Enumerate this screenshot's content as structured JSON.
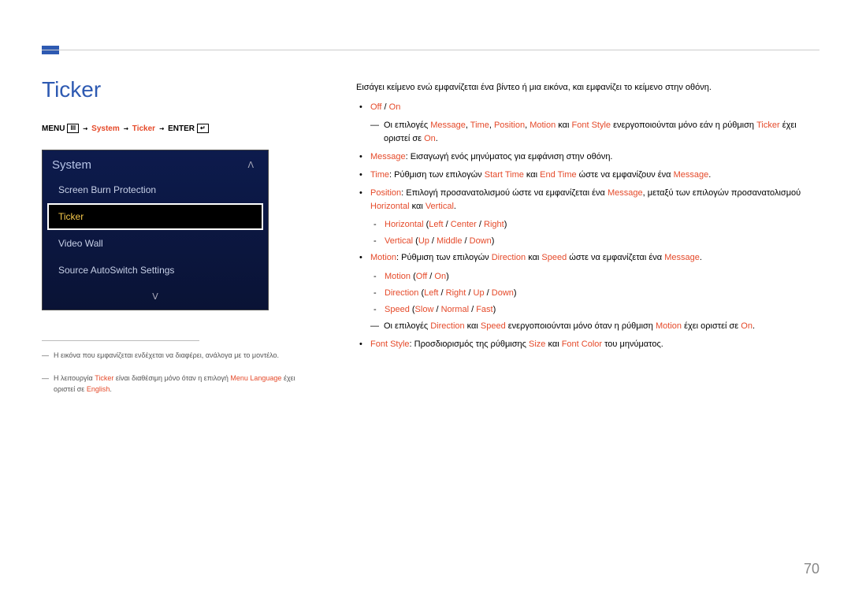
{
  "title": "Ticker",
  "breadcrumb": {
    "menu_label": "MENU",
    "menu_icon": "III",
    "system": "System",
    "ticker": "Ticker",
    "enter": "ENTER",
    "enter_icon": "↵"
  },
  "menu": {
    "header": "System",
    "chev_up": "ᐱ",
    "chev_down": "ᐯ",
    "items": [
      {
        "label": "Screen Burn Protection",
        "selected": false
      },
      {
        "label": "Ticker",
        "selected": true
      },
      {
        "label": "Video Wall",
        "selected": false
      },
      {
        "label": "Source AutoSwitch Settings",
        "selected": false
      }
    ]
  },
  "footnotes": [
    {
      "text": "Η εικόνα που εμφανίζεται ενδέχεται να διαφέρει, ανάλογα με το μοντέλο."
    },
    {
      "pre": "Η λειτουργία ",
      "k1": "Ticker",
      "mid": " είναι διαθέσιμη μόνο όταν η επιλογή ",
      "k2": "Menu Language",
      "post": " έχει οριστεί σε ",
      "k3": "English",
      "end": "."
    }
  ],
  "content": {
    "intro": "Εισάγει κείμενο ενώ εμφανίζεται ένα βίντεο ή μια εικόνα, και εμφανίζει το κείμενο στην οθόνη.",
    "off": "Off",
    "on": "On",
    "sep": " / ",
    "note1": {
      "pre": "Οι επιλογές ",
      "k1": "Message",
      "c1": ", ",
      "k2": "Time",
      "c2": ", ",
      "k3": "Position",
      "c3": ", ",
      "k4": "Motion",
      "c4": " και ",
      "k5": "Font Style",
      "mid": " ενεργοποιούνται μόνο εάν η ρύθμιση ",
      "k6": "Ticker",
      "mid2": " έχει οριστεί σε ",
      "k7": "On",
      "end": "."
    },
    "msg": {
      "k": "Message",
      "post": ": Εισαγωγή ενός μηνύματος για εμφάνιση στην οθόνη."
    },
    "time": {
      "k": "Time",
      "pre": ": Ρύθμιση των επιλογών ",
      "k1": "Start Time",
      "and": " και ",
      "k2": "End Time",
      "mid": " ώστε να εμφανίζουν ένα ",
      "k3": "Message",
      "end": "."
    },
    "position": {
      "k": "Position",
      "pre": ": Επιλογή προσανατολισμού ώστε να εμφανίζεται ένα ",
      "k1": "Message",
      "mid": ", μεταξύ των επιλογών προσανατολισμού ",
      "k2": "Horizontal",
      "and": " και ",
      "k3": "Vertical",
      "end": "."
    },
    "horiz": {
      "k": "Horizontal",
      "open": " (",
      "a": "Left",
      "b": "Center",
      "c": "Right",
      "close": ")"
    },
    "vert": {
      "k": "Vertical",
      "open": " (",
      "a": "Up",
      "b": "Middle",
      "c": "Down",
      "close": ")"
    },
    "motion_line": {
      "k": "Motion",
      "pre": ": Ρύθμιση των επιλογών ",
      "k1": "Direction",
      "and": " και ",
      "k2": "Speed",
      "mid": " ώστε να εμφανίζεται ένα ",
      "k3": "Message",
      "end": "."
    },
    "motion_sub": {
      "k": "Motion",
      "open": " (",
      "a": "Off",
      "b": "On",
      "close": ")"
    },
    "direction_sub": {
      "k": "Direction",
      "open": " (",
      "a": "Left",
      "b": "Right",
      "c": "Up",
      "d": "Down",
      "close": ")"
    },
    "speed_sub": {
      "k": "Speed",
      "open": " (",
      "a": "Slow",
      "b": "Normal",
      "c": "Fast",
      "close": ")"
    },
    "note2": {
      "pre": "Οι επιλογές ",
      "k1": "Direction",
      "and": " και ",
      "k2": "Speed",
      "mid": " ενεργοποιούνται μόνο όταν η ρύθμιση ",
      "k3": "Motion",
      "mid2": " έχει οριστεί σε ",
      "k4": "On",
      "end": "."
    },
    "fontstyle": {
      "k": "Font Style",
      "pre": ": Προσδιορισμός της ρύθμισης ",
      "k1": "Size",
      "and": " και ",
      "k2": "Font Color",
      "post": " του μηνύματος."
    }
  },
  "page_number": "70"
}
